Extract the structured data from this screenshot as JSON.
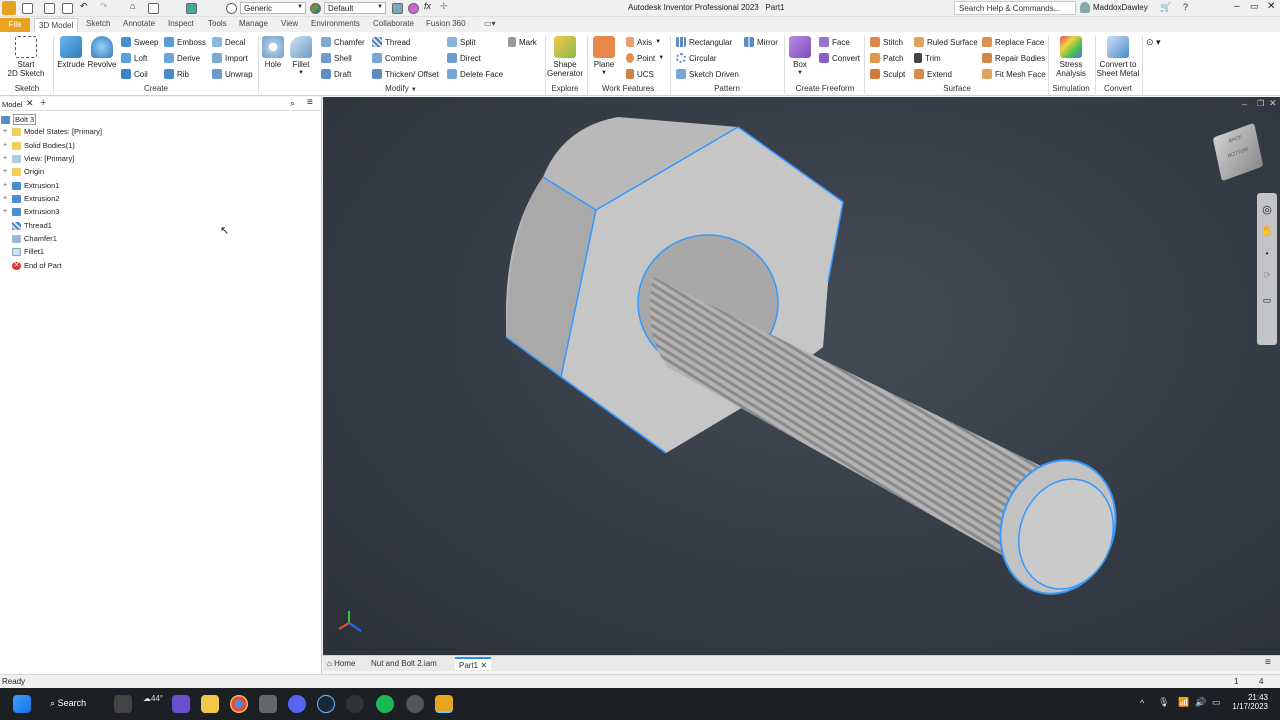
{
  "titlebar": {
    "title": "Autodesk Inventor Professional 2023",
    "doc": "Part1",
    "material": "Generic",
    "appearance": "Default",
    "search_placeholder": "Search Help & Commands...",
    "user": "MaddoxDawley"
  },
  "tabs": [
    "File",
    "3D Model",
    "Sketch",
    "Annotate",
    "Inspect",
    "Tools",
    "Manage",
    "View",
    "Environments",
    "Collaborate",
    "Fusion 360"
  ],
  "active_tab": "3D Model",
  "ribbon": {
    "sketch": {
      "start": "Start",
      "start2": "2D Sketch",
      "group": "Sketch"
    },
    "create": {
      "extrude": "Extrude",
      "revolve": "Revolve",
      "sweep": "Sweep",
      "loft": "Loft",
      "coil": "Coil",
      "emboss": "Emboss",
      "derive": "Derive",
      "rib": "Rib",
      "decal": "Decal",
      "import": "Import",
      "unwrap": "Unwrap",
      "group": "Create"
    },
    "modify": {
      "hole": "Hole",
      "fillet": "Fillet",
      "chamfer": "Chamfer",
      "shell": "Shell",
      "draft": "Draft",
      "thread": "Thread",
      "combine": "Combine",
      "thicken": "Thicken/ Offset",
      "split": "Split",
      "direct": "Direct",
      "delete_face": "Delete Face",
      "mark": "Mark",
      "group": "Modify"
    },
    "explore": {
      "shape1": "Shape",
      "shape2": "Generator",
      "group": "Explore"
    },
    "work": {
      "plane": "Plane",
      "axis": "Axis",
      "point": "Point",
      "ucs": "UCS",
      "group": "Work Features"
    },
    "pattern": {
      "rect": "Rectangular",
      "circ": "Circular",
      "sketch": "Sketch Driven",
      "mirror": "Mirror",
      "group": "Pattern"
    },
    "freeform": {
      "box": "Box",
      "face": "Face",
      "convert": "Convert",
      "group": "Create Freeform"
    },
    "surface": {
      "stitch": "Stitch",
      "patch": "Patch",
      "sculpt": "Sculpt",
      "ruled": "Ruled Surface",
      "trim": "Trim",
      "extend": "Extend",
      "replace": "Replace Face",
      "repair": "Repair Bodies",
      "fitmesh": "Fit Mesh Face",
      "group": "Surface"
    },
    "simulation": {
      "s1": "Stress",
      "s2": "Analysis",
      "group": "Simulation"
    },
    "convert": {
      "c1": "Convert to",
      "c2": "Sheet Metal",
      "group": "Convert"
    }
  },
  "browser": {
    "tab": "Model",
    "root": "Bolt 3",
    "nodes": [
      "Model States: [Primary]",
      "Solid Bodies(1)",
      "View: [Primary]",
      "Origin",
      "Extrusion1",
      "Extrusion2",
      "Extrusion3",
      "Thread1",
      "Chamfer1",
      "Fillet1",
      "End of Part"
    ]
  },
  "viewcube": {
    "face1": "BACK",
    "face2": "BOTTOM"
  },
  "doctabs": {
    "home": "Home",
    "asm": "Nut and Bolt 2.iam",
    "part": "Part1"
  },
  "status": {
    "text": "Ready",
    "n1": "1",
    "n2": "4"
  },
  "taskbar": {
    "search": "Search",
    "weather": "44°",
    "time": "21:43",
    "date": "1/17/2023"
  },
  "colors": {
    "accent": "#1e90ff",
    "file_tab": "#e8a420",
    "viewport": "#383e48"
  }
}
